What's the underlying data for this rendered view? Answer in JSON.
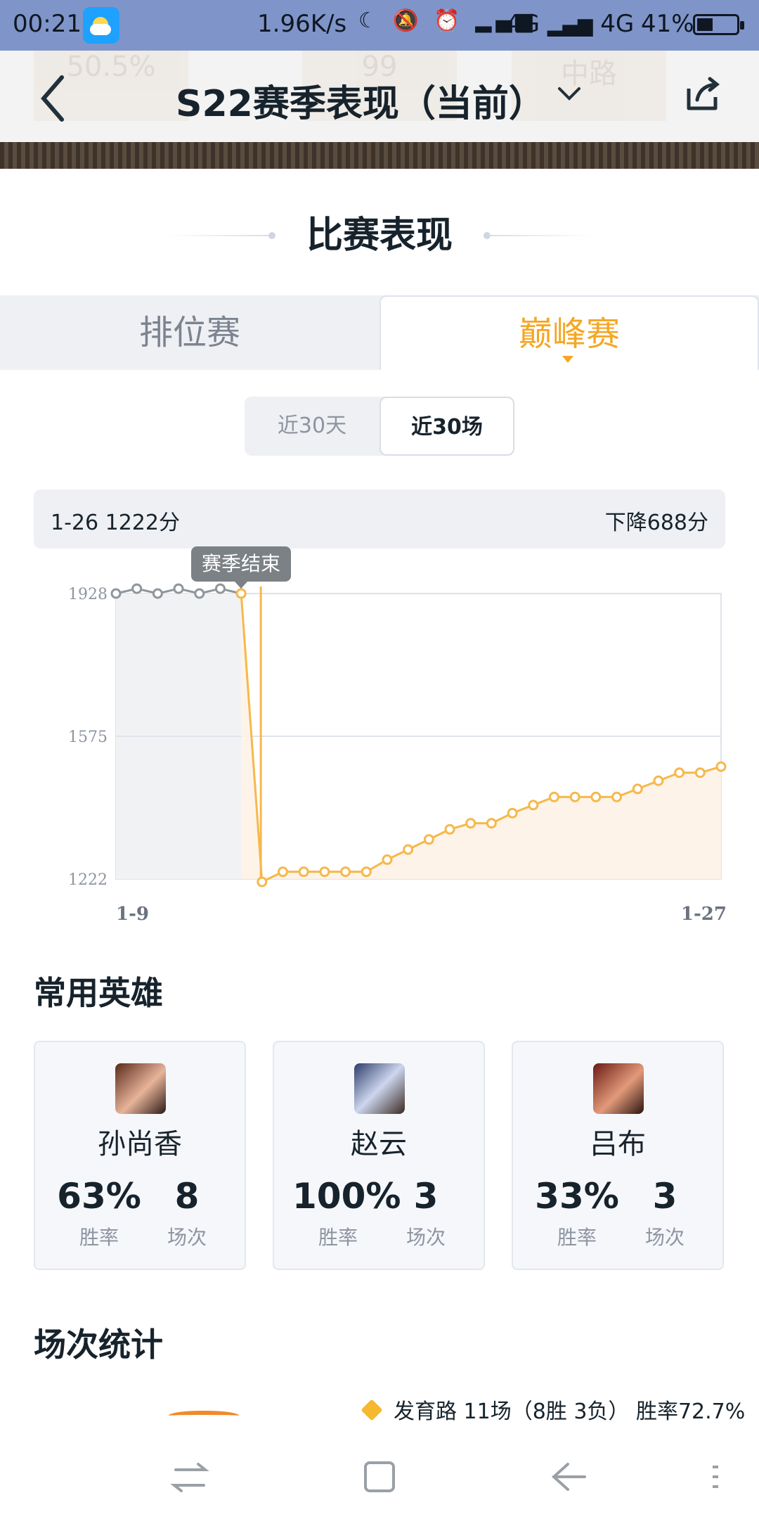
{
  "status_bar": {
    "time": "00:21",
    "net_speed": "1.96K/s",
    "signal_1": "4G",
    "signal_2": "4G",
    "battery": "41%",
    "battery_level": 0.41
  },
  "header": {
    "title": "S22赛季表现（当前）",
    "ghost_texts": [
      "50.5%",
      "99",
      "中路"
    ]
  },
  "section": {
    "title": "比赛表现"
  },
  "tabs": [
    {
      "label": "排位赛",
      "selected": false
    },
    {
      "label": "巅峰赛",
      "selected": true
    }
  ],
  "range": {
    "options": [
      "近30天",
      "近30场"
    ],
    "selected_index": 1
  },
  "summary": {
    "left": "1-26 1222分",
    "right": "下降688分"
  },
  "tooltip": "赛季结束",
  "chart_data": {
    "type": "line",
    "y_ticks": [
      "1928",
      "1575",
      "1222"
    ],
    "ylim": [
      1222,
      1928
    ],
    "x_labels": [
      "1-9",
      "1-27"
    ],
    "series": [
      {
        "values": [
          1928,
          1940,
          1928,
          1940,
          1928,
          1940,
          1928
        ]
      },
      {
        "values": [
          1928,
          1215,
          1240,
          1240,
          1240,
          1240,
          1240,
          1270,
          1295,
          1320,
          1345,
          1360,
          1360,
          1385,
          1405,
          1425,
          1425,
          1425,
          1425,
          1445,
          1465,
          1485,
          1485,
          1500
        ]
      }
    ],
    "colors": {
      "past": "#8f969c",
      "current": "#f6b84c"
    }
  },
  "heroes": {
    "title": "常用英雄",
    "items": [
      {
        "name": "孙尚香",
        "win_rate": "63%",
        "win_rate_label": "胜率",
        "games": "8",
        "games_label": "场次"
      },
      {
        "name": "赵云",
        "win_rate": "100%",
        "win_rate_label": "胜率",
        "games": "3",
        "games_label": "场次"
      },
      {
        "name": "吕布",
        "win_rate": "33%",
        "win_rate_label": "胜率",
        "games": "3",
        "games_label": "场次"
      }
    ]
  },
  "stats": {
    "title": "场次统计",
    "legend": "发育路 11场（8胜 3负） 胜率72.7%"
  }
}
